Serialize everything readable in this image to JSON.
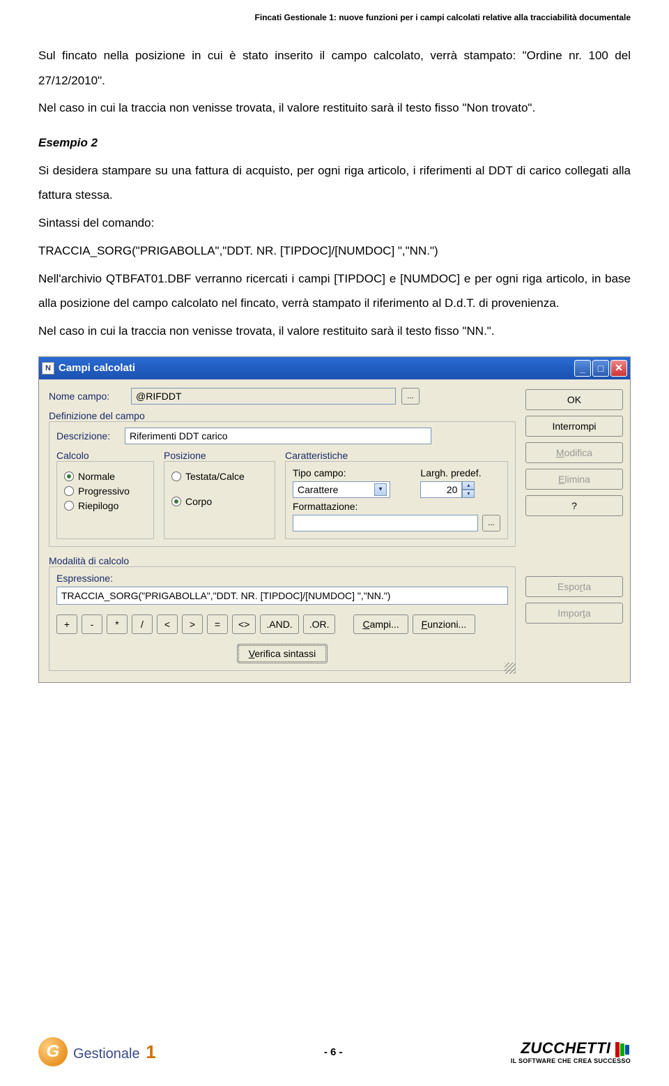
{
  "header": "Fincati Gestionale 1: nuove funzioni per i campi calcolati relative alla tracciabilità documentale",
  "body": {
    "p1": "Sul fincato nella posizione in cui è stato inserito il campo calcolato, verrà stampato: \"Ordine nr. 100 del 27/12/2010\".",
    "p2": "Nel caso in cui la traccia non venisse trovata, il valore restituito sarà il testo fisso \"Non trovato\".",
    "ex": "Esempio 2",
    "p3": "Si desidera stampare su una fattura di acquisto, per ogni riga articolo, i riferimenti al DDT di carico collegati alla fattura stessa.",
    "p4": "Sintassi del comando:",
    "p5": "TRACCIA_SORG(\"PRIGABOLLA\",\"DDT. NR. [TIPDOC]/[NUMDOC] \",\"NN.\")",
    "p6": "Nell'archivio QTBFAT01.DBF verranno ricercati i campi [TIPDOC] e [NUMDOC] e per ogni riga articolo, in base alla posizione del campo calcolato nel fincato, verrà stampato il riferimento al D.d.T. di provenienza.",
    "p7": "Nel caso in cui la traccia non venisse trovata, il valore restituito sarà il testo fisso \"NN.\"."
  },
  "window": {
    "title": "Campi calcolati",
    "form": {
      "nome_label": "Nome campo:",
      "nome_value": "@RIFDDT",
      "def_title": "Definizione del campo",
      "descr_label": "Descrizione:",
      "descr_value": "Riferimenti DDT carico",
      "calcolo_title": "Calcolo",
      "calcolo_opts": [
        "Normale",
        "Progressivo",
        "Riepilogo"
      ],
      "posizione_title": "Posizione",
      "posizione_opts": [
        "Testata/Calce",
        "Corpo"
      ],
      "caratt_title": "Caratteristiche",
      "tipo_label": "Tipo campo:",
      "tipo_value": "Carattere",
      "largh_label": "Largh. predef.",
      "largh_value": "20",
      "formatt_label": "Formattazione:",
      "modal_title": "Modalità di calcolo",
      "espr_label": "Espressione:",
      "espr_value": "TRACCIA_SORG(\"PRIGABOLLA\",\"DDT. NR. [TIPDOC]/[NUMDOC] \",\"NN.\")",
      "ops": [
        "+",
        "-",
        "*",
        "/",
        "<",
        ">",
        "=",
        "<>",
        ".AND.",
        ".OR."
      ],
      "campi_btn": "Campi...",
      "funz_btn": "Funzioni...",
      "verify_btn": "Verifica sintassi"
    },
    "side": {
      "ok": "OK",
      "interrompi": "Interrompi",
      "modifica": "Modifica",
      "elimina": "Elimina",
      "help": "?",
      "esporta": "Esporta",
      "importa": "Importa"
    }
  },
  "footer": {
    "g1_text": "Gestionale",
    "g1_num": "1",
    "page": "- 6 -",
    "z_top": "ZUCCHETTI",
    "z_sub": "IL SOFTWARE CHE CREA SUCCESSO"
  }
}
